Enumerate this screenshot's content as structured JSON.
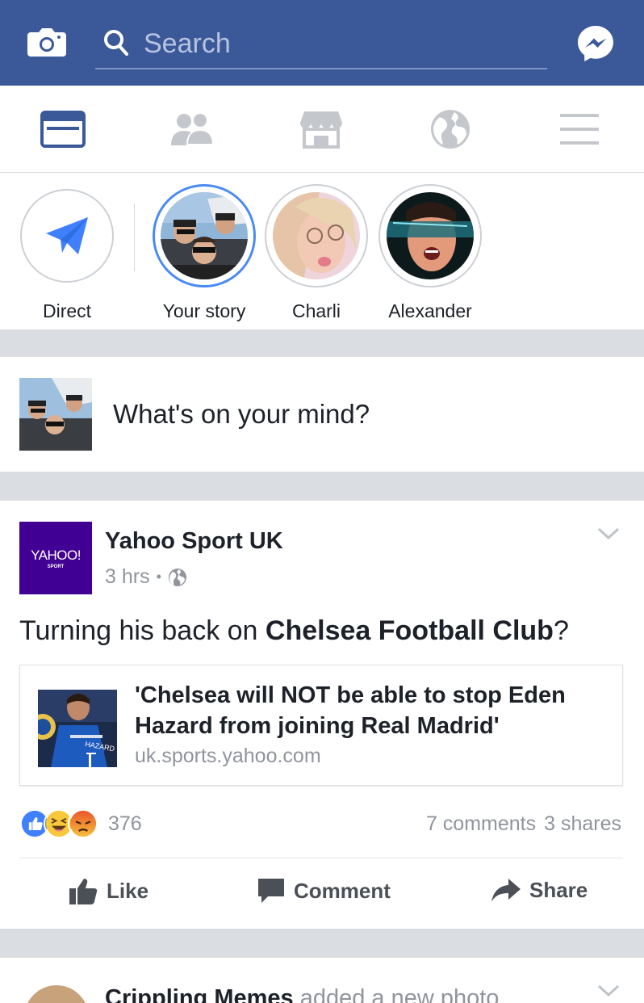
{
  "header": {
    "search_placeholder": "Search"
  },
  "stories": [
    {
      "label": "Direct"
    },
    {
      "label": "Your story"
    },
    {
      "label": "Charli"
    },
    {
      "label": "Alexander"
    }
  ],
  "composer": {
    "prompt": "What's on your mind?"
  },
  "post": {
    "author": "Yahoo Sport UK",
    "logo_text": "YAHOO!",
    "logo_sub": "SPORT",
    "time": "3 hrs",
    "separator": "•",
    "text_pre": "Turning his back on ",
    "text_bold": "Chelsea Football Club",
    "text_post": "?",
    "link": {
      "title": "'Chelsea will NOT be able to stop Eden Hazard from joining Real Madrid'",
      "domain": "uk.sports.yahoo.com",
      "thumb_caption": "HAZARD"
    },
    "reaction_count": "376",
    "comments": "7 comments",
    "shares": "3 shares",
    "actions": {
      "like": "Like",
      "comment": "Comment",
      "share": "Share"
    }
  },
  "next_post": {
    "author": "Crippling Memes",
    "action_text": " added a new photo."
  },
  "colors": {
    "brand": "#3b5998",
    "story_ring_active": "#4a8af4",
    "like_blue": "#4080ff"
  }
}
